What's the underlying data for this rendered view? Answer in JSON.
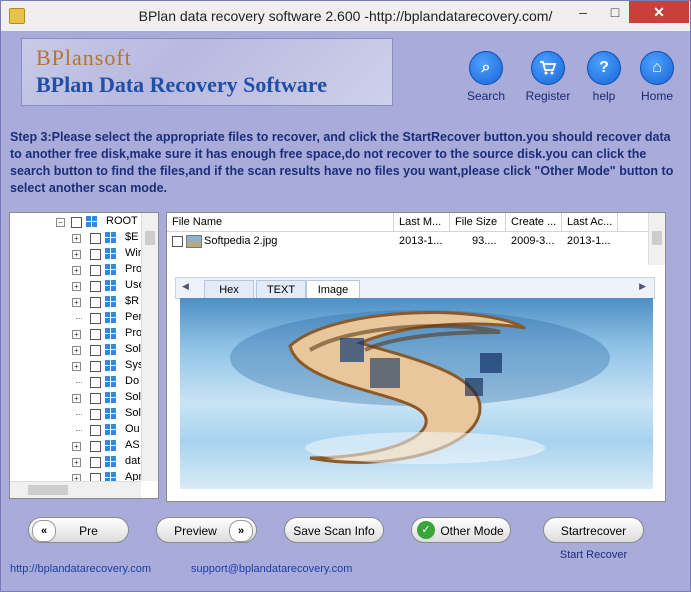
{
  "window": {
    "title": "BPlan data recovery software   2.600 -http://bplandatarecovery.com/",
    "min_label": "–",
    "max_label": "□",
    "close_label": "✕"
  },
  "logo": {
    "brand": "BPlansoft",
    "name": "BPlan Data Recovery Software"
  },
  "toolbar": [
    {
      "label": "Search",
      "icon": "search-icon",
      "glyph": "⌕"
    },
    {
      "label": "Register",
      "icon": "cart-icon",
      "glyph": "🛒"
    },
    {
      "label": "help",
      "icon": "help-icon",
      "glyph": "?"
    },
    {
      "label": "Home",
      "icon": "home-icon",
      "glyph": "⌂"
    }
  ],
  "instructions": "Step 3:Please select the appropriate files to recover, and click the StartRecover button.you should recover data to another free disk,make sure it has enough free space,do not recover to the source disk.you can click the search button to find the files,and if the scan results have no files you want,please click \"Other Mode\" button to select another scan mode.",
  "tree": {
    "root": "ROOT",
    "items": [
      {
        "label": "$E",
        "expandable": true
      },
      {
        "label": "Wir",
        "expandable": true
      },
      {
        "label": "Pro",
        "expandable": true
      },
      {
        "label": "Use",
        "expandable": true
      },
      {
        "label": "$R",
        "expandable": true
      },
      {
        "label": "Per",
        "expandable": false
      },
      {
        "label": "Pro",
        "expandable": true
      },
      {
        "label": "Sol",
        "expandable": true
      },
      {
        "label": "Sys",
        "expandable": true
      },
      {
        "label": "Do",
        "expandable": false
      },
      {
        "label": "Sol",
        "expandable": true
      },
      {
        "label": "Sol",
        "expandable": false
      },
      {
        "label": "Ou",
        "expandable": false
      },
      {
        "label": "AS",
        "expandable": true
      },
      {
        "label": "dat",
        "expandable": true
      },
      {
        "label": "Apr",
        "expandable": true
      }
    ]
  },
  "files": {
    "columns": [
      "File Name",
      "Last M...",
      "File Size",
      "Create ...",
      "Last Ac..."
    ],
    "rows": [
      {
        "name": "Softpedia 2.jpg",
        "last_modified": "2013-1...",
        "size": "93....",
        "created": "2009-3...",
        "last_access": "2013-1..."
      }
    ]
  },
  "preview_tabs": {
    "hex": "Hex",
    "text": "TEXT",
    "image": "Image",
    "active": "Image"
  },
  "buttons": {
    "pre": "Pre",
    "preview": "Preview",
    "save_scan": "Save Scan Info",
    "other_mode": "Other Mode",
    "start_recover": "Startrecover",
    "start_recover_caption": "Start Recover"
  },
  "footer": {
    "website": "http://bplandatarecovery.com",
    "email": "support@bplandatarecovery.com"
  }
}
